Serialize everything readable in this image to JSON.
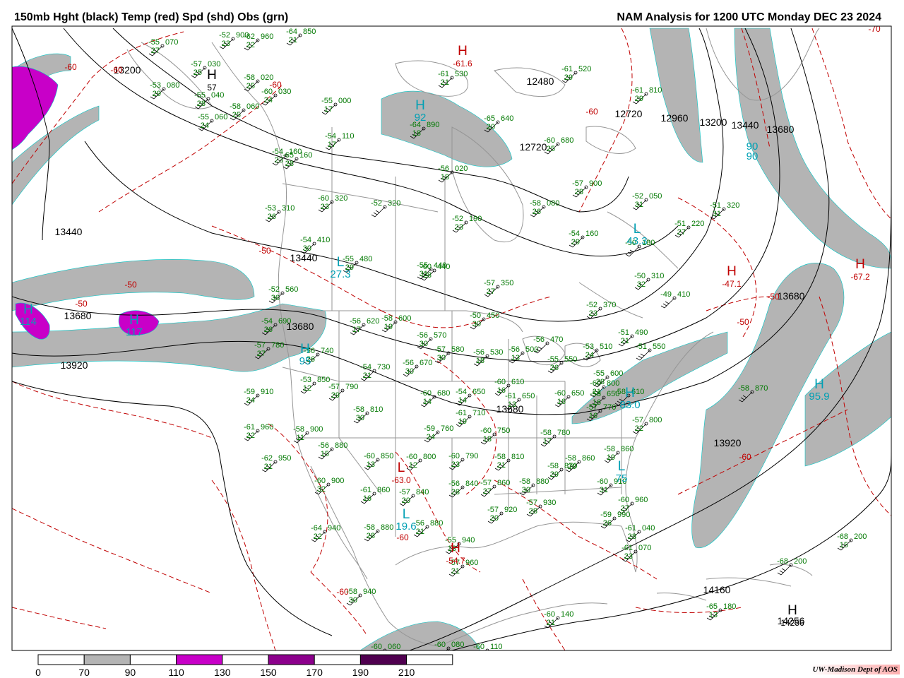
{
  "header": {
    "left_title": "150mb Hght (black) Temp (red) Spd (shd) Obs (grn)",
    "right_title": "NAM Analysis for 1200 UTC Monday  DEC 23 2024"
  },
  "colors": {
    "height_contour": "#000000",
    "temp_contour": "#c00000",
    "speed_70_90": "#b4b4b4",
    "speed_110_130": "#c800c8",
    "speed_150_170": "#8c008c",
    "speed_190_210": "#500050",
    "obs_text": "#007800",
    "center_label": "#00a0b4",
    "map_lines": "#969696"
  },
  "height_labels": [
    {
      "text": "13200"
    },
    {
      "text": "12480"
    },
    {
      "text": "12720"
    },
    {
      "text": "12720"
    },
    {
      "text": "12960"
    },
    {
      "text": "13200"
    },
    {
      "text": "13440"
    },
    {
      "text": "13680"
    },
    {
      "text": "13440"
    },
    {
      "text": "13440"
    },
    {
      "text": "13680"
    },
    {
      "text": "13680"
    },
    {
      "text": "13920"
    },
    {
      "text": "13680"
    },
    {
      "text": "13680"
    },
    {
      "text": "13920"
    },
    {
      "text": "14160"
    },
    {
      "text": "14256"
    }
  ],
  "temp_labels": [
    {
      "text": "-60"
    },
    {
      "text": "-60"
    },
    {
      "text": "-60"
    },
    {
      "text": "-50"
    },
    {
      "text": "-50"
    },
    {
      "text": "-50"
    },
    {
      "text": "-50"
    },
    {
      "text": "-50"
    },
    {
      "text": "-60"
    },
    {
      "text": "-60"
    },
    {
      "text": "-60"
    },
    {
      "text": "-70"
    },
    {
      "text": "-60"
    }
  ],
  "centers": [
    {
      "letter": "H",
      "value": "57",
      "kind": "height"
    },
    {
      "letter": "H",
      "value": "-61.6",
      "kind": "temp"
    },
    {
      "letter": "H",
      "value": "-47.1",
      "kind": "temp"
    },
    {
      "letter": "H",
      "value": "-54.7",
      "kind": "temp"
    },
    {
      "letter": "H",
      "value": "14256",
      "kind": "height"
    },
    {
      "letter": "H",
      "value": "-67.2",
      "kind": "temp"
    },
    {
      "letter": "L",
      "value": "-63.0",
      "kind": "temp"
    },
    {
      "letter": "H",
      "value": "92",
      "kind": "speed"
    },
    {
      "letter": "H",
      "value": "114",
      "kind": "speed"
    },
    {
      "letter": "H",
      "value": "117",
      "kind": "speed"
    },
    {
      "letter": "L",
      "value": "27.3",
      "kind": "speed"
    },
    {
      "letter": "L",
      "value": "43.3",
      "kind": "speed"
    },
    {
      "letter": "H",
      "value": "95.9",
      "kind": "speed"
    },
    {
      "letter": "L",
      "value": "19.6",
      "kind": "speed"
    },
    {
      "letter": "L",
      "value": "75",
      "kind": "speed"
    },
    {
      "letter": "H",
      "value": "95",
      "kind": "speed"
    },
    {
      "letter": "H",
      "value": "83.0",
      "kind": "speed"
    },
    {
      "letter": "",
      "value": "90",
      "kind": "speed"
    },
    {
      "letter": "",
      "value": "90",
      "kind": "speed"
    }
  ],
  "observations": [
    {
      "t": "-55",
      "h": "070",
      "d": "27"
    },
    {
      "t": "-52",
      "h": "900",
      "d": "23"
    },
    {
      "t": "-62",
      "h": "960",
      "d": "22"
    },
    {
      "t": "-64",
      "h": "850",
      "d": "21"
    },
    {
      "t": "-57",
      "h": "030",
      "d": "25"
    },
    {
      "t": "-53",
      "h": "080",
      "d": "29"
    },
    {
      "t": "-58",
      "h": "020",
      "d": "25"
    },
    {
      "t": "-60",
      "h": "030",
      "d": "24"
    },
    {
      "t": "-55",
      "h": "040",
      "d": "28"
    },
    {
      "t": "-58",
      "h": "060",
      "d": "25"
    },
    {
      "t": "-55",
      "h": "060",
      "d": "24"
    },
    {
      "t": "-55",
      "h": "000",
      "d": "17"
    },
    {
      "t": "-61",
      "h": "530",
      "d": "21"
    },
    {
      "t": "-61",
      "h": "520",
      "d": "29"
    },
    {
      "t": "-61",
      "h": "810",
      "d": "29"
    },
    {
      "t": "-65",
      "h": "640",
      "d": "20"
    },
    {
      "t": "-64",
      "h": "890",
      "d": "18"
    },
    {
      "t": "-54",
      "h": "110",
      "d": "17"
    },
    {
      "t": "-54",
      "h": "160",
      "d": "23"
    },
    {
      "t": "-65",
      "h": "160",
      "d": "28"
    },
    {
      "t": "-56",
      "h": "020",
      "d": "18"
    },
    {
      "t": "-60",
      "h": "680",
      "d": "25"
    },
    {
      "t": "-57",
      "h": "900",
      "d": "28"
    },
    {
      "t": "-60",
      "h": "320",
      "d": "23"
    },
    {
      "t": "-52",
      "h": "320",
      "d": ""
    },
    {
      "t": "-52",
      "h": "050",
      "d": "31"
    },
    {
      "t": "-58",
      "h": "080",
      "d": "26"
    },
    {
      "t": "-53",
      "h": "310",
      "d": "26"
    },
    {
      "t": "-51",
      "h": "320",
      "d": "31"
    },
    {
      "t": "-52",
      "h": "190",
      "d": "23"
    },
    {
      "t": "-51",
      "h": "220",
      "d": "27"
    },
    {
      "t": "-54",
      "h": "160",
      "d": "29"
    },
    {
      "t": "-54",
      "h": "410",
      "d": "30"
    },
    {
      "t": "-50",
      "h": "180",
      "d": ""
    },
    {
      "t": "-55",
      "h": "480",
      "d": "29"
    },
    {
      "t": "-55",
      "h": "440",
      "d": "31"
    },
    {
      "t": "-60",
      "h": "440",
      "d": "28"
    },
    {
      "t": "-57",
      "h": "350",
      "d": "27"
    },
    {
      "t": "-52",
      "h": "560",
      "d": "36"
    },
    {
      "t": "-50",
      "h": "310",
      "d": "32"
    },
    {
      "t": "-49",
      "h": "410",
      "d": ""
    },
    {
      "t": "-52",
      "h": "370",
      "d": "23"
    },
    {
      "t": "-58",
      "h": "600",
      "d": "19"
    },
    {
      "t": "-56",
      "h": "620",
      "d": "17"
    },
    {
      "t": "-50",
      "h": "450",
      "d": "30"
    },
    {
      "t": "-54",
      "h": "690",
      "d": "26"
    },
    {
      "t": "-56",
      "h": "570",
      "d": "30"
    },
    {
      "t": "-56",
      "h": "530",
      "d": "18"
    },
    {
      "t": "-56",
      "h": "500",
      "d": "13"
    },
    {
      "t": "-56",
      "h": "470",
      "d": ""
    },
    {
      "t": "-51",
      "h": "490",
      "d": "21"
    },
    {
      "t": "-57",
      "h": "780",
      "d": "27"
    },
    {
      "t": "-56",
      "h": "740",
      "d": "26"
    },
    {
      "t": "-57",
      "h": "580",
      "d": "30"
    },
    {
      "t": "-53",
      "h": "510",
      "d": "24"
    },
    {
      "t": "-51",
      "h": "550",
      "d": ""
    },
    {
      "t": "-55",
      "h": "550",
      "d": "26"
    },
    {
      "t": "-54",
      "h": "730",
      "d": "21"
    },
    {
      "t": "-56",
      "h": "670",
      "d": "30"
    },
    {
      "t": "-53",
      "h": "850",
      "d": "12"
    },
    {
      "t": "-60",
      "h": "800",
      "d": "21"
    },
    {
      "t": "-57",
      "h": "790",
      "d": "29"
    },
    {
      "t": "-55",
      "h": "600",
      "d": "28"
    },
    {
      "t": "-54",
      "h": "650",
      "d": "14"
    },
    {
      "t": "-58",
      "h": "870",
      "d": ""
    },
    {
      "t": "-60",
      "h": "610",
      "d": "16"
    },
    {
      "t": "-60",
      "h": "680",
      "d": "14"
    },
    {
      "t": "-61",
      "h": "650",
      "d": "13"
    },
    {
      "t": "-60",
      "h": "650",
      "d": "16"
    },
    {
      "t": "-58",
      "h": "650",
      "d": "16"
    },
    {
      "t": "-58",
      "h": "610",
      "d": ""
    },
    {
      "t": "-59",
      "h": "910",
      "d": "24"
    },
    {
      "t": "-58",
      "h": "810",
      "d": "30"
    },
    {
      "t": "-61",
      "h": "710",
      "d": "19"
    },
    {
      "t": "-57",
      "h": "770",
      "d": "16"
    },
    {
      "t": "-57",
      "h": "800",
      "d": "22"
    },
    {
      "t": "-61",
      "h": "960",
      "d": "22"
    },
    {
      "t": "-58",
      "h": "900",
      "d": "11"
    },
    {
      "t": "-59",
      "h": "760",
      "d": "24"
    },
    {
      "t": "-60",
      "h": "750",
      "d": "18"
    },
    {
      "t": "-58",
      "h": "780",
      "d": "17"
    },
    {
      "t": "-58",
      "h": "860",
      "d": "19"
    },
    {
      "t": "-56",
      "h": "880",
      "d": "15"
    },
    {
      "t": "-60",
      "h": "850",
      "d": "13"
    },
    {
      "t": "-60",
      "h": "800",
      "d": "12"
    },
    {
      "t": "-60",
      "h": "790",
      "d": "23"
    },
    {
      "t": "-58",
      "h": "810",
      "d": "21"
    },
    {
      "t": "-58",
      "h": "870",
      "d": "29"
    },
    {
      "t": "-58",
      "h": "860",
      "d": "20"
    },
    {
      "t": "-62",
      "h": "950",
      "d": "21"
    },
    {
      "t": "-60",
      "h": "900",
      "d": "32"
    },
    {
      "t": "-61",
      "h": "860",
      "d": "16"
    },
    {
      "t": "-57",
      "h": "840",
      "d": "20"
    },
    {
      "t": "-56",
      "h": "840",
      "d": "28"
    },
    {
      "t": "-57",
      "h": "860",
      "d": "27"
    },
    {
      "t": "-58",
      "h": "880",
      "d": "30"
    },
    {
      "t": "-60",
      "h": "910",
      "d": "31"
    },
    {
      "t": "-60",
      "h": "960",
      "d": "27"
    },
    {
      "t": "-64",
      "h": "940",
      "d": "22"
    },
    {
      "t": "-58",
      "h": "880",
      "d": "28"
    },
    {
      "t": "-56",
      "h": "880",
      "d": "21"
    },
    {
      "t": "-57",
      "h": "920",
      "d": "20"
    },
    {
      "t": "-57",
      "h": "930",
      "d": "28"
    },
    {
      "t": "-59",
      "h": "990",
      "d": "26"
    },
    {
      "t": "-61",
      "h": "040",
      "d": "28"
    },
    {
      "t": "-55",
      "h": "940",
      "d": "18"
    },
    {
      "t": "-57",
      "h": "960",
      "d": "21"
    },
    {
      "t": "-61",
      "h": "070",
      "d": "23"
    },
    {
      "t": "-68",
      "h": "200",
      "d": "15"
    },
    {
      "t": "-68",
      "h": "200",
      "d": ""
    },
    {
      "t": "-58",
      "h": "940",
      "d": "30"
    },
    {
      "t": "-65",
      "h": "180",
      "d": "13"
    },
    {
      "t": "-60",
      "h": "140",
      "d": "21"
    },
    {
      "t": "-60",
      "h": "060",
      "d": ""
    },
    {
      "t": "-60",
      "h": "080",
      "d": ""
    },
    {
      "t": "-60",
      "h": "110",
      "d": ""
    }
  ],
  "legend": {
    "ticks": [
      "0",
      "70",
      "90",
      "110",
      "130",
      "150",
      "170",
      "190",
      "210"
    ],
    "credit": "UW-Madison  Dept of AOS"
  }
}
